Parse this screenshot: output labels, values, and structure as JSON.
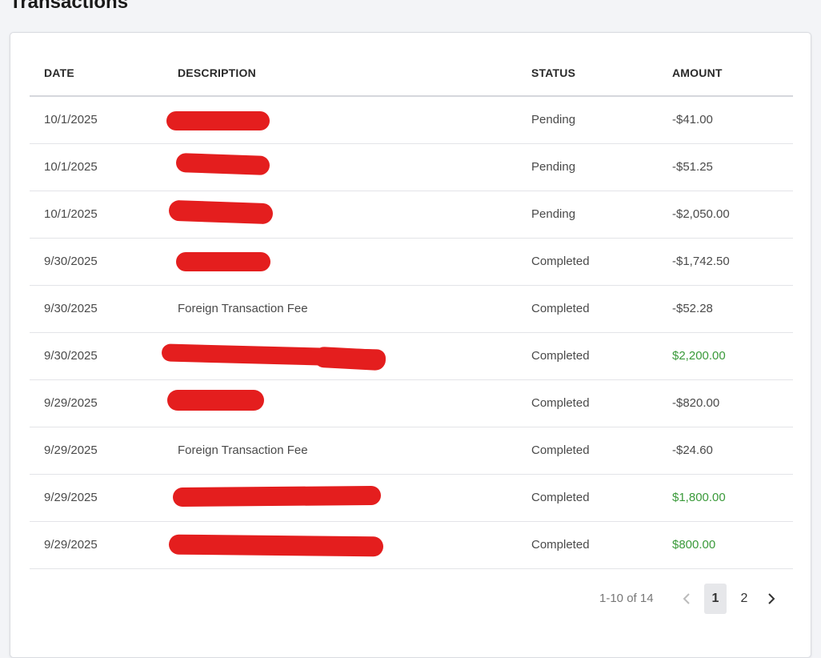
{
  "page": {
    "title": "Transactions"
  },
  "table": {
    "columns": [
      "DATE",
      "DESCRIPTION",
      "STATUS",
      "AMOUNT"
    ],
    "rows": [
      {
        "date": "10/1/2025",
        "description": "",
        "status": "Pending",
        "amount": "-$41.00",
        "amount_type": "debit"
      },
      {
        "date": "10/1/2025",
        "description": "",
        "status": "Pending",
        "amount": "-$51.25",
        "amount_type": "debit"
      },
      {
        "date": "10/1/2025",
        "description": "",
        "status": "Pending",
        "amount": "-$2,050.00",
        "amount_type": "debit"
      },
      {
        "date": "9/30/2025",
        "description": "",
        "status": "Completed",
        "amount": "-$1,742.50",
        "amount_type": "debit"
      },
      {
        "date": "9/30/2025",
        "description": "Foreign Transaction Fee",
        "status": "Completed",
        "amount": "-$52.28",
        "amount_type": "debit"
      },
      {
        "date": "9/30/2025",
        "description": "",
        "status": "Completed",
        "amount": "$2,200.00",
        "amount_type": "credit"
      },
      {
        "date": "9/29/2025",
        "description": "",
        "status": "Completed",
        "amount": "-$820.00",
        "amount_type": "debit"
      },
      {
        "date": "9/29/2025",
        "description": "Foreign Transaction Fee",
        "status": "Completed",
        "amount": "-$24.60",
        "amount_type": "debit"
      },
      {
        "date": "9/29/2025",
        "description": "",
        "status": "Completed",
        "amount": "$1,800.00",
        "amount_type": "credit"
      },
      {
        "date": "9/29/2025",
        "description": "",
        "status": "Completed",
        "amount": "$800.00",
        "amount_type": "credit"
      }
    ]
  },
  "pagination": {
    "range_label": "1-10 of 14",
    "pages": [
      "1",
      "2"
    ],
    "current_page": "1",
    "prev_icon": "chevron-left-icon",
    "next_icon": "chevron-right-icon"
  },
  "colors": {
    "credit": "#3a9a3a",
    "redaction": "#e41e1e",
    "page_background": "#f3f4f7",
    "card_background": "#ffffff"
  }
}
